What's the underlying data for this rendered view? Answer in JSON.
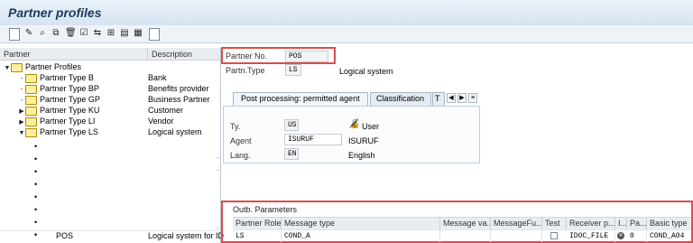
{
  "title": "Partner profiles",
  "toolbar": {
    "icons": [
      "new-icon",
      "edit-icon",
      "display-icon",
      "copy-icon",
      "delete-icon",
      "check-icon",
      "compare-icon",
      "tree-icon",
      "layout-icon",
      "details-icon",
      "table-icon"
    ]
  },
  "tree": {
    "headers": {
      "partner": "Partner",
      "description": "Description"
    },
    "items": [
      {
        "label": "Partner Profiles",
        "desc": ""
      },
      {
        "label": "Partner Type B",
        "desc": "Bank"
      },
      {
        "label": "Partner Type BP",
        "desc": "Benefits provider"
      },
      {
        "label": "Partner Type GP",
        "desc": "Business Partner"
      },
      {
        "label": "Partner Type KU",
        "desc": "Customer"
      },
      {
        "label": "Partner Type LI",
        "desc": "Vendor"
      },
      {
        "label": "Partner Type LS",
        "desc": "Logical system"
      }
    ],
    "selected": {
      "label": "POS",
      "desc": "Logical system for ID"
    }
  },
  "partner": {
    "no_label": "Partner No.",
    "no_value": "POS",
    "type_label": "Partn.Type",
    "type_value": "LS",
    "type_desc": "Logical system"
  },
  "tabs": {
    "active": "Post processing: permitted agent",
    "second": "Classification",
    "third": "T"
  },
  "agent": {
    "ty_label": "Ty.",
    "ty_value": "US",
    "ty_desc": "User",
    "agent_label": "Agent",
    "agent_value": "ISURUF",
    "agent_desc": "ISURUF",
    "lang_label": "Lang.",
    "lang_value": "EN",
    "lang_desc": "English"
  },
  "outbound": {
    "title": "Outb. Parameters",
    "columns": [
      "Partner Role",
      "Message type",
      "Message va...",
      "MessageFu...",
      "Test",
      "Receiver p...",
      "I...",
      "Pa...",
      "Basic type"
    ],
    "row": {
      "role": "LS",
      "msgtype": "COND_A",
      "receiver": "IDOC_FILE",
      "pa": "0",
      "basic": "COND_A04"
    }
  },
  "colors": {
    "highlight": "#e24b4b",
    "title": "#1e3a5f"
  }
}
